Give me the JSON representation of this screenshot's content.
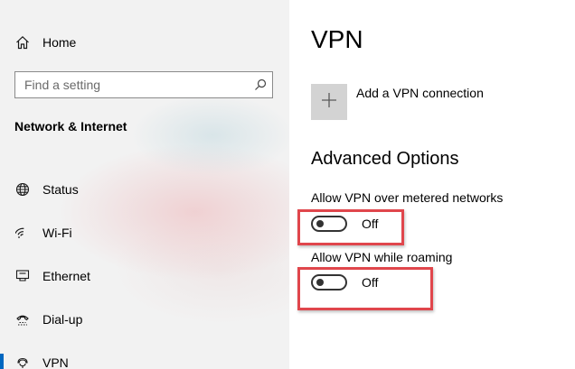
{
  "sidebar": {
    "home_label": "Home",
    "search_placeholder": "Find a setting",
    "section_title": "Network & Internet",
    "items": [
      {
        "label": "Status",
        "icon": "globe-icon"
      },
      {
        "label": "Wi-Fi",
        "icon": "wifi-icon"
      },
      {
        "label": "Ethernet",
        "icon": "ethernet-icon"
      },
      {
        "label": "Dial-up",
        "icon": "dial-up-icon"
      },
      {
        "label": "VPN",
        "icon": "vpn-icon",
        "selected": true
      }
    ]
  },
  "main": {
    "title": "VPN",
    "add_connection_label": "Add a VPN connection",
    "advanced_heading": "Advanced Options",
    "settings": [
      {
        "label": "Allow VPN over metered networks",
        "state": "Off",
        "on": false
      },
      {
        "label": "Allow VPN while roaming",
        "state": "Off",
        "on": false
      }
    ]
  },
  "colors": {
    "accent": "#0067c0",
    "highlight_border": "#e0464c",
    "sidebar_background": "#f2f2f2",
    "add_tile": "#d3d3d3"
  }
}
